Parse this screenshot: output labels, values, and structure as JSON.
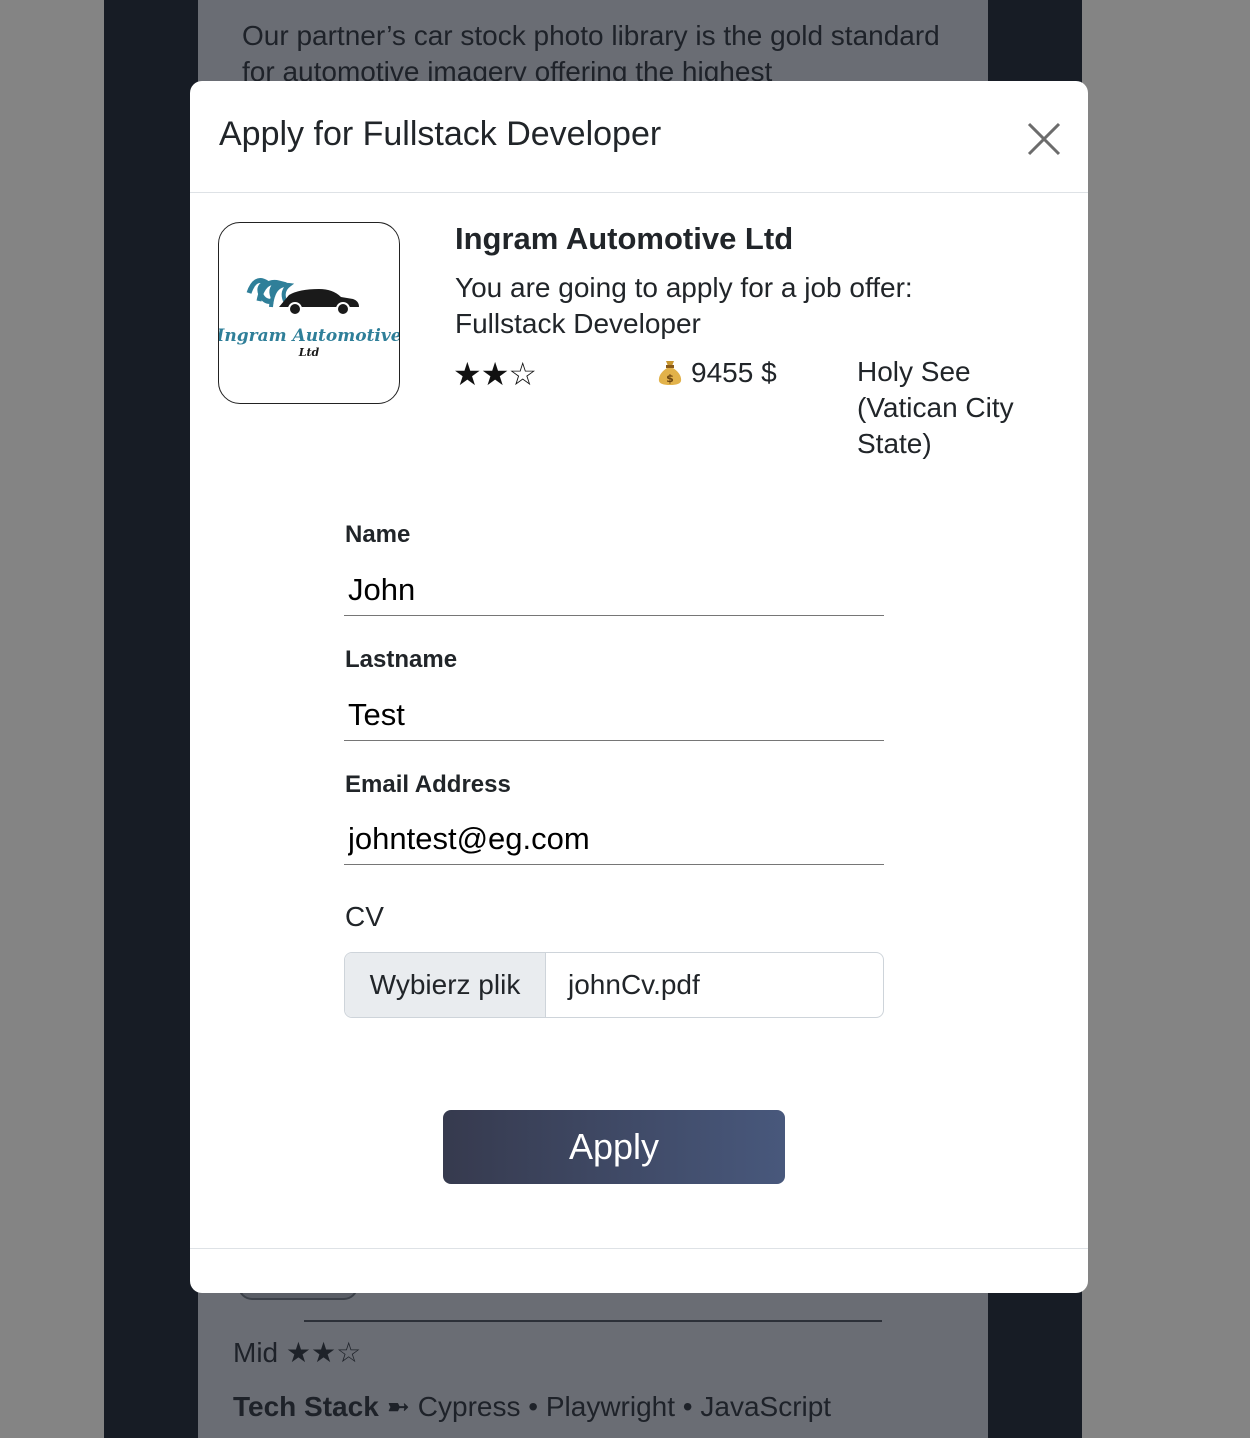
{
  "background": {
    "description": "Our partner’s car stock photo library is the gold standard for automotive imagery offering the highest",
    "level_label": "Mid",
    "level_stars": "★★☆",
    "tech_stack_label": "Tech Stack ➼",
    "tech_stack": "Cypress • Playwright • JavaScript"
  },
  "modal": {
    "title": "Apply for Fullstack Developer",
    "close_icon": "close-icon",
    "company": {
      "name": "Ingram Automotive Ltd",
      "logo_text": "Ingram Automotive",
      "logo_subtext": "Ltd"
    },
    "offer": {
      "intro": "You are going to apply for a job offer: Fullstack Developer",
      "stars": "★★☆",
      "salary": "9455 $",
      "salary_icon": "money-bag-icon",
      "location": "Holy See (Vatican City State)"
    },
    "form": {
      "name_label": "Name",
      "name_value": "John",
      "lastname_label": "Lastname",
      "lastname_value": "Test",
      "email_label": "Email Address",
      "email_value": "johntest@eg.com",
      "cv_label": "CV",
      "file_button": "Wybierz plik",
      "file_name": "johnCv.pdf"
    },
    "apply_button": "Apply"
  },
  "colors": {
    "apply_gradient_start": "#363a4e",
    "apply_gradient_end": "#48587c",
    "logo_teal": "#2f7f99"
  }
}
